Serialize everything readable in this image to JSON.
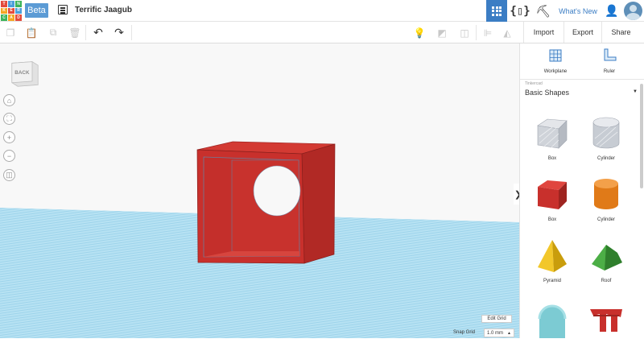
{
  "header": {
    "logo_letters": [
      "TIN",
      "KER",
      "CAD"
    ],
    "logo_colors": [
      "#e34a3c",
      "#4c9fdb",
      "#3cb45b",
      "#f5a623",
      "#e34a3c",
      "#4c9fdb",
      "#3cb45b",
      "#f5a623",
      "#e34a3c"
    ],
    "beta_label": "Beta",
    "design_title": "Terrific Jaagub",
    "whats_new": "What's New"
  },
  "toolbar": {
    "import_label": "Import",
    "export_label": "Export",
    "share_label": "Share"
  },
  "viewport": {
    "navcube_label": "BACK",
    "edit_grid_label": "Edit Grid",
    "snap_grid_label": "Snap Grid",
    "snap_grid_value": "1.0 mm",
    "snap_grid_arrow": "▲"
  },
  "panel": {
    "workplane_label": "Workplane",
    "ruler_label": "Ruler",
    "library_owner": "Tinkercad",
    "library_name": "Basic Shapes",
    "dropdown_arrow": "▼",
    "shapes": [
      {
        "label": "Box",
        "icon": "box-hole-icon"
      },
      {
        "label": "Cylinder",
        "icon": "cylinder-hole-icon"
      },
      {
        "label": "Box",
        "icon": "box-icon"
      },
      {
        "label": "Cylinder",
        "icon": "cylinder-icon"
      },
      {
        "label": "Pyramid",
        "icon": "pyramid-icon"
      },
      {
        "label": "Roof",
        "icon": "roof-icon"
      }
    ]
  },
  "colors": {
    "accent": "#3b7dc4",
    "shape_red": "#c8302c",
    "shape_orange": "#e87e1c",
    "shape_yellow": "#f0c419",
    "shape_green": "#3ea03b",
    "workplane_blue": "#b7e2f3"
  }
}
